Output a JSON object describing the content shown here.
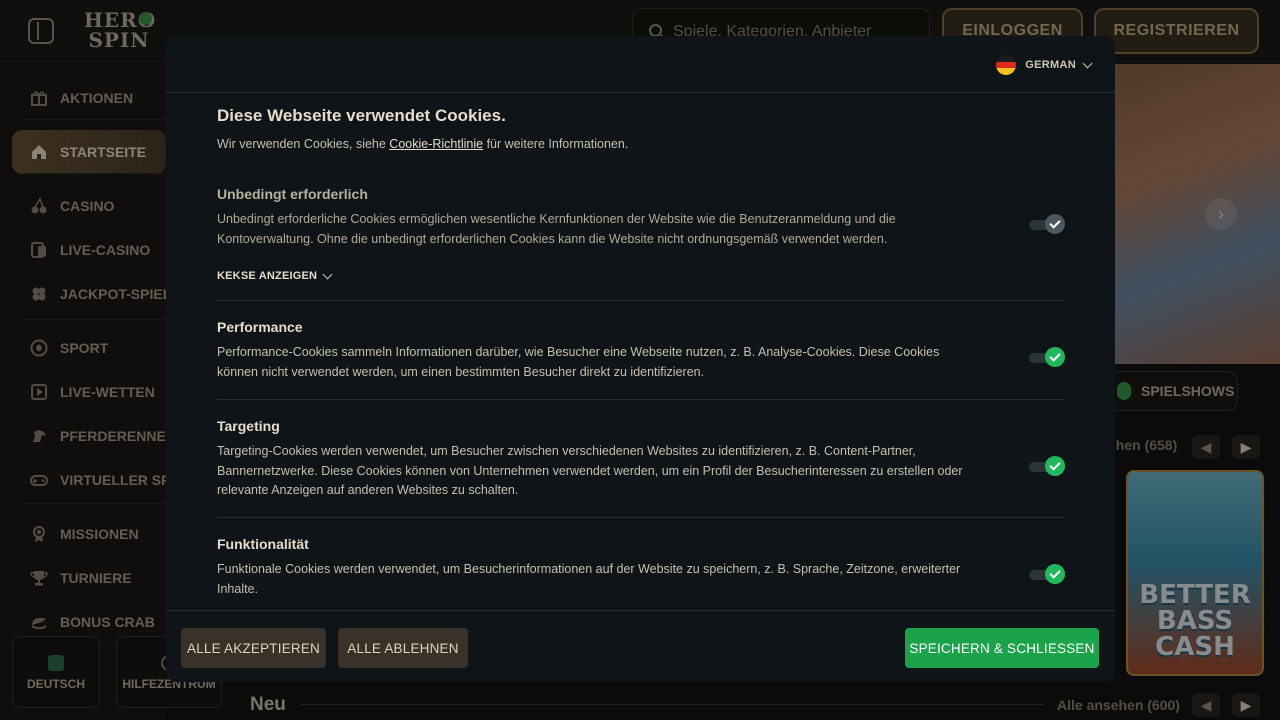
{
  "header": {
    "logo_line1": "HERO",
    "logo_line2": "SPIN",
    "search_placeholder": "Spiele, Kategorien, Anbieter",
    "login_label": "EINLOGGEN",
    "register_label": "REGISTRIEREN"
  },
  "sidebar": {
    "items": [
      {
        "label": "AKTIONEN",
        "icon": "gift-icon"
      },
      {
        "label": "STARTSEITE",
        "icon": "home-icon",
        "active": true
      },
      {
        "label": "CASINO",
        "icon": "cherries-icon"
      },
      {
        "label": "LIVE-CASINO",
        "icon": "live-cards-icon"
      },
      {
        "label": "JACKPOT-SPIELE",
        "icon": "clover-icon"
      },
      {
        "label": "SPORT",
        "icon": "soccer-ball-icon"
      },
      {
        "label": "LIVE-WETTEN",
        "icon": "live-bet-icon"
      },
      {
        "label": "PFERDERENNEN",
        "icon": "horse-icon"
      },
      {
        "label": "VIRTUELLER SPORT",
        "icon": "gamepad-icon"
      },
      {
        "label": "MISSIONEN",
        "icon": "medal-icon"
      },
      {
        "label": "TURNIERE",
        "icon": "trophy-icon"
      },
      {
        "label": "BONUS CRAB",
        "icon": "crab-icon"
      }
    ],
    "footer": {
      "language_label": "DEUTSCH",
      "help_label": "HILFEZENTRUM"
    }
  },
  "main": {
    "chip_label": "SPIELSHOWS",
    "section_count": "ehen (658)",
    "game_tile_text": "BETTER BASS CASH",
    "new_section_title": "Neu",
    "new_section_all": "Alle ansehen (600)"
  },
  "cookie_modal": {
    "language": "GERMAN",
    "title": "Diese Webseite verwendet Cookies.",
    "intro_before": "Wir verwenden Cookies, siehe ",
    "intro_link": "Cookie-Richtlinie",
    "intro_after": " für weitere Informationen.",
    "show_cookies_label": "KEKSE ANZEIGEN",
    "categories": [
      {
        "title": "Unbedingt erforderlich",
        "description": "Unbedingt erforderliche Cookies ermöglichen wesentliche Kernfunktionen der Website wie die Benutzeranmeldung und die Kontoverwaltung. Ohne die unbedingt erforderlichen Cookies kann die Website nicht ordnungsgemäß verwendet werden.",
        "enabled": true,
        "locked": true
      },
      {
        "title": "Performance",
        "description": "Performance-Cookies sammeln Informationen darüber, wie Besucher eine Webseite nutzen, z. B. Analyse-Cookies. Diese Cookies können nicht verwendet werden, um einen bestimmten Besucher direkt zu identifizieren.",
        "enabled": true,
        "locked": false
      },
      {
        "title": "Targeting",
        "description": "Targeting-Cookies werden verwendet, um Besucher zwischen verschiedenen Websites zu identifizieren, z. B. Content-Partner, Bannernetzwerke. Diese Cookies können von Unternehmen verwendet werden, um ein Profil der Besucherinteressen zu erstellen oder relevante Anzeigen auf anderen Websites zu schalten.",
        "enabled": true,
        "locked": false
      },
      {
        "title": "Funktionalität",
        "description": "Funktionale Cookies werden verwendet, um Besucherinformationen auf der Website zu speichern, z. B. Sprache, Zeitzone, erweiterter Inhalte.",
        "enabled": true,
        "locked": false
      }
    ],
    "accept_all_label": "ALLE AKZEPTIEREN",
    "decline_all_label": "ALLE ABLEHNEN",
    "save_close_label": "SPEICHERN & SCHLIESSEN"
  },
  "colors": {
    "toggle_on": "#1fb85a",
    "toggle_locked": "#4f575c",
    "save_button": "#1ba34a",
    "secondary_button": "#3a3229",
    "modal_bg": "#0e1417"
  }
}
